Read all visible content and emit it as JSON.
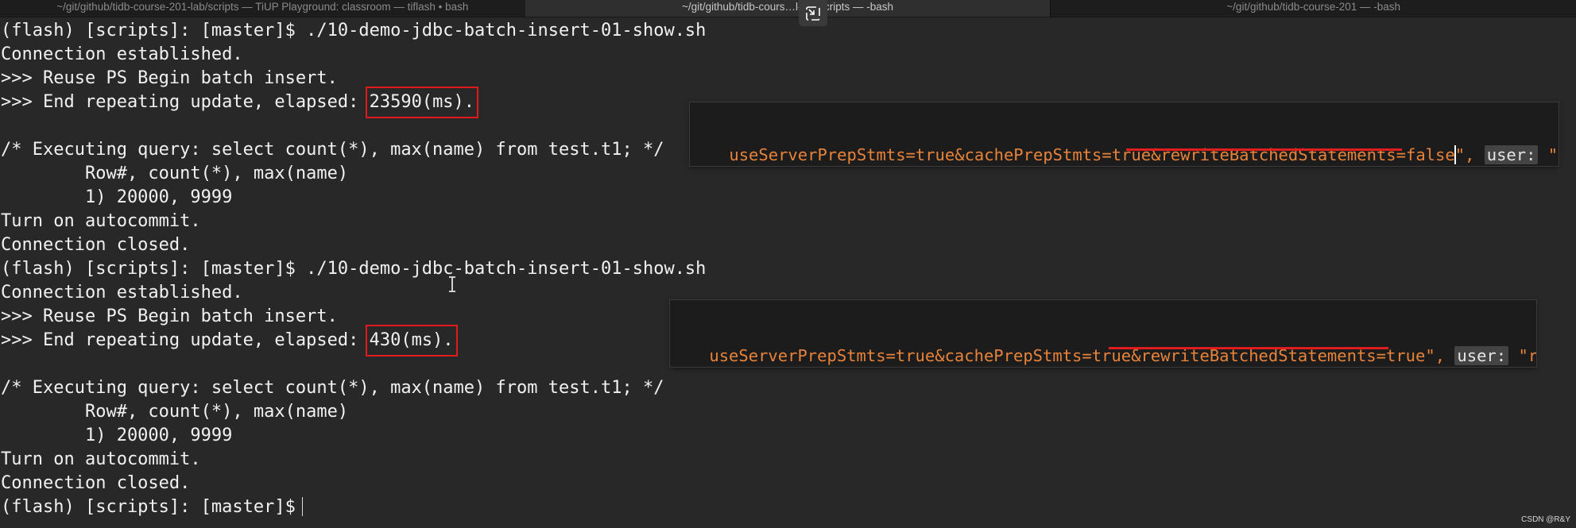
{
  "tabs": [
    {
      "title": "~/git/github/tidb-course-201-lab/scripts — TiUP Playground: classroom — tiflash • bash"
    },
    {
      "title": "~/git/github/tidb-cours…l-lab/scripts — -bash"
    },
    {
      "title": "~/git/github/tidb-course-201 — -bash"
    }
  ],
  "terminal": {
    "lines": [
      "(flash) [scripts]: [master]$ ./10-demo-jdbc-batch-insert-01-show.sh",
      "Connection established.",
      ">>> Reuse PS Begin batch insert.",
      ">>> End repeating update, elapsed: ",
      "23590(ms).",
      "",
      "/* Executing query: select count(*), max(name) from test.t1; */",
      "        Row#, count(*), max(name)",
      "        1) 20000, 9999",
      "Turn on autocommit.",
      "Connection closed.",
      "(flash) [scripts]: [master]$ ./10-demo-jdbc-batch-insert-01-show.sh",
      "Connection established.",
      ">>> Reuse PS Begin batch insert.",
      ">>> End repeating update, elapsed: ",
      "430(ms).",
      "",
      "/* Executing query: select count(*), max(name) from test.t1; */",
      "        Row#, count(*), max(name)",
      "        1) 20000, 9999",
      "Turn on autocommit.",
      "Connection closed.",
      "(flash) [scripts]: [master]$"
    ]
  },
  "config_snippets": [
    {
      "prefix": "useServerPrepStmts=true&cachePrepStmts=true&",
      "highlight": "rewriteBatchedStatements=false",
      "quote": "\",",
      "key": "user:",
      "value": "\"root\""
    },
    {
      "prefix": "useServerPrepStmts=true&cachePrepStmts=true&",
      "highlight": "rewriteBatchedStatements=true",
      "quote": "\",",
      "key": "user:",
      "value": "\"root\""
    }
  ],
  "watermark": "CSDN @R&Y",
  "colors": {
    "terminal_bg": "#282828",
    "terminal_fg": "#f1f1f1",
    "highlight_box": "#e11b1b",
    "string_orange": "#e8833a",
    "string_green": "#6cbf67"
  }
}
